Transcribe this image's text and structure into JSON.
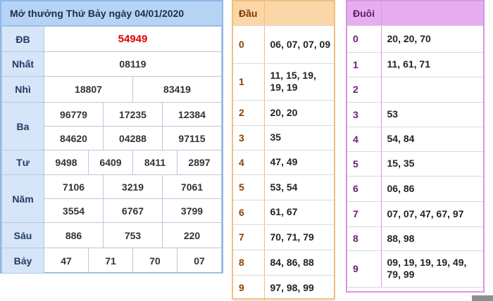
{
  "results": {
    "title": "Mở thưởng Thứ Bảy ngày 04/01/2020",
    "rows": [
      {
        "label": "ĐB",
        "values": [
          "54949"
        ]
      },
      {
        "label": "Nhất",
        "values": [
          "08119"
        ]
      },
      {
        "label": "Nhì",
        "values": [
          "18807",
          "83419"
        ]
      },
      {
        "label": "Ba",
        "values": [
          "96779",
          "17235",
          "12384",
          "84620",
          "04288",
          "97115"
        ]
      },
      {
        "label": "Tư",
        "values": [
          "9498",
          "6409",
          "8411",
          "2897"
        ]
      },
      {
        "label": "Năm",
        "values": [
          "7106",
          "3219",
          "7061",
          "3554",
          "6767",
          "3799"
        ]
      },
      {
        "label": "Sáu",
        "values": [
          "886",
          "753",
          "220"
        ]
      },
      {
        "label": "Bảy",
        "values": [
          "47",
          "71",
          "70",
          "07"
        ]
      }
    ]
  },
  "dau": {
    "header": "Đầu",
    "rows": [
      {
        "key": "0",
        "value": "06, 07, 07, 09"
      },
      {
        "key": "1",
        "value": "11, 15, 19, 19, 19"
      },
      {
        "key": "2",
        "value": "20, 20"
      },
      {
        "key": "3",
        "value": "35"
      },
      {
        "key": "4",
        "value": "47, 49"
      },
      {
        "key": "5",
        "value": "53, 54"
      },
      {
        "key": "6",
        "value": "61, 67"
      },
      {
        "key": "7",
        "value": "70, 71, 79"
      },
      {
        "key": "8",
        "value": "84, 86, 88"
      },
      {
        "key": "9",
        "value": "97, 98, 99"
      }
    ]
  },
  "duoi": {
    "header": "Đuôi",
    "rows": [
      {
        "key": "0",
        "value": "20, 20, 70"
      },
      {
        "key": "1",
        "value": "11, 61, 71"
      },
      {
        "key": "2",
        "value": ""
      },
      {
        "key": "3",
        "value": "53"
      },
      {
        "key": "4",
        "value": "54, 84"
      },
      {
        "key": "5",
        "value": "15, 35"
      },
      {
        "key": "6",
        "value": "06, 86"
      },
      {
        "key": "7",
        "value": "07, 07, 47, 67, 97"
      },
      {
        "key": "8",
        "value": "88, 98"
      },
      {
        "key": "9",
        "value": "09, 19, 19, 19, 49, 79, 99"
      }
    ]
  },
  "colors": {
    "results_header_bg": "#b6d3f5",
    "results_label_bg": "#d6e6f8",
    "special_prize": "#e00000",
    "dau_header_bg": "#fbd6a6",
    "duoi_header_bg": "#e6aef0"
  }
}
